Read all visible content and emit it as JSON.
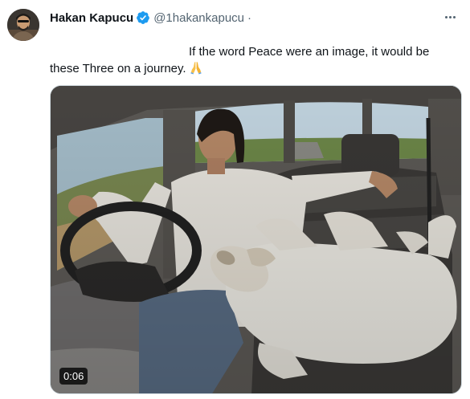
{
  "author": {
    "display_name": "Hakan Kapucu",
    "handle": "@1hakankapucu",
    "separator": "·"
  },
  "tweet": {
    "line1": "If the word Peace were an image, it would be",
    "line2": "these Three on a journey."
  },
  "media": {
    "duration": "0:06"
  },
  "icons": {
    "verified": "verified-badge-icon",
    "more": "more-options-icon",
    "emoji": "folded-hands-emoji"
  },
  "colors": {
    "verified_blue": "#1d9bf0",
    "secondary_text": "#536471"
  }
}
